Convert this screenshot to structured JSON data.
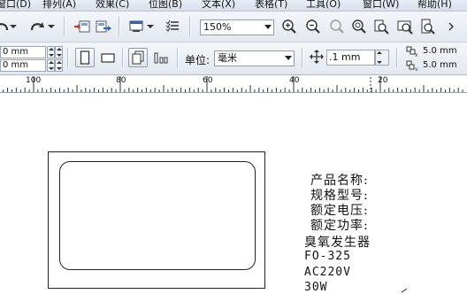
{
  "menubar": {
    "items": [
      {
        "label": "窗口(D)"
      },
      {
        "label": "排列(A)"
      },
      {
        "label": "效果(C)"
      },
      {
        "label": "位图(B)"
      },
      {
        "label": "文本(X)"
      },
      {
        "label": "表格(T)"
      },
      {
        "label": "工具(O)"
      },
      {
        "label": "窗口(W)"
      },
      {
        "label": "帮助(H)"
      }
    ]
  },
  "toolbar1": {
    "zoom_value": "150%"
  },
  "property_bar": {
    "width_value": "0 mm",
    "height_value": "0 mm",
    "units_label": "单位:",
    "units_value": "毫米",
    "nudge_value": ".1 mm",
    "dup_x_value": "5.0 mm",
    "dup_y_value": "5.0 mm"
  },
  "ruler": {
    "ticks": [
      "100",
      "80",
      "60",
      "40",
      "20"
    ]
  },
  "document": {
    "lines": [
      "产品名称:",
      "规格型号:",
      "额定电压:",
      "额定功率:",
      "臭氧发生器",
      "FO-325",
      "AC220V",
      "30W"
    ]
  },
  "colors": {
    "menubar_bg": "#dfe6f1",
    "toolbar_bg": "#eceff5",
    "canvas_bg": "#ffffff"
  }
}
